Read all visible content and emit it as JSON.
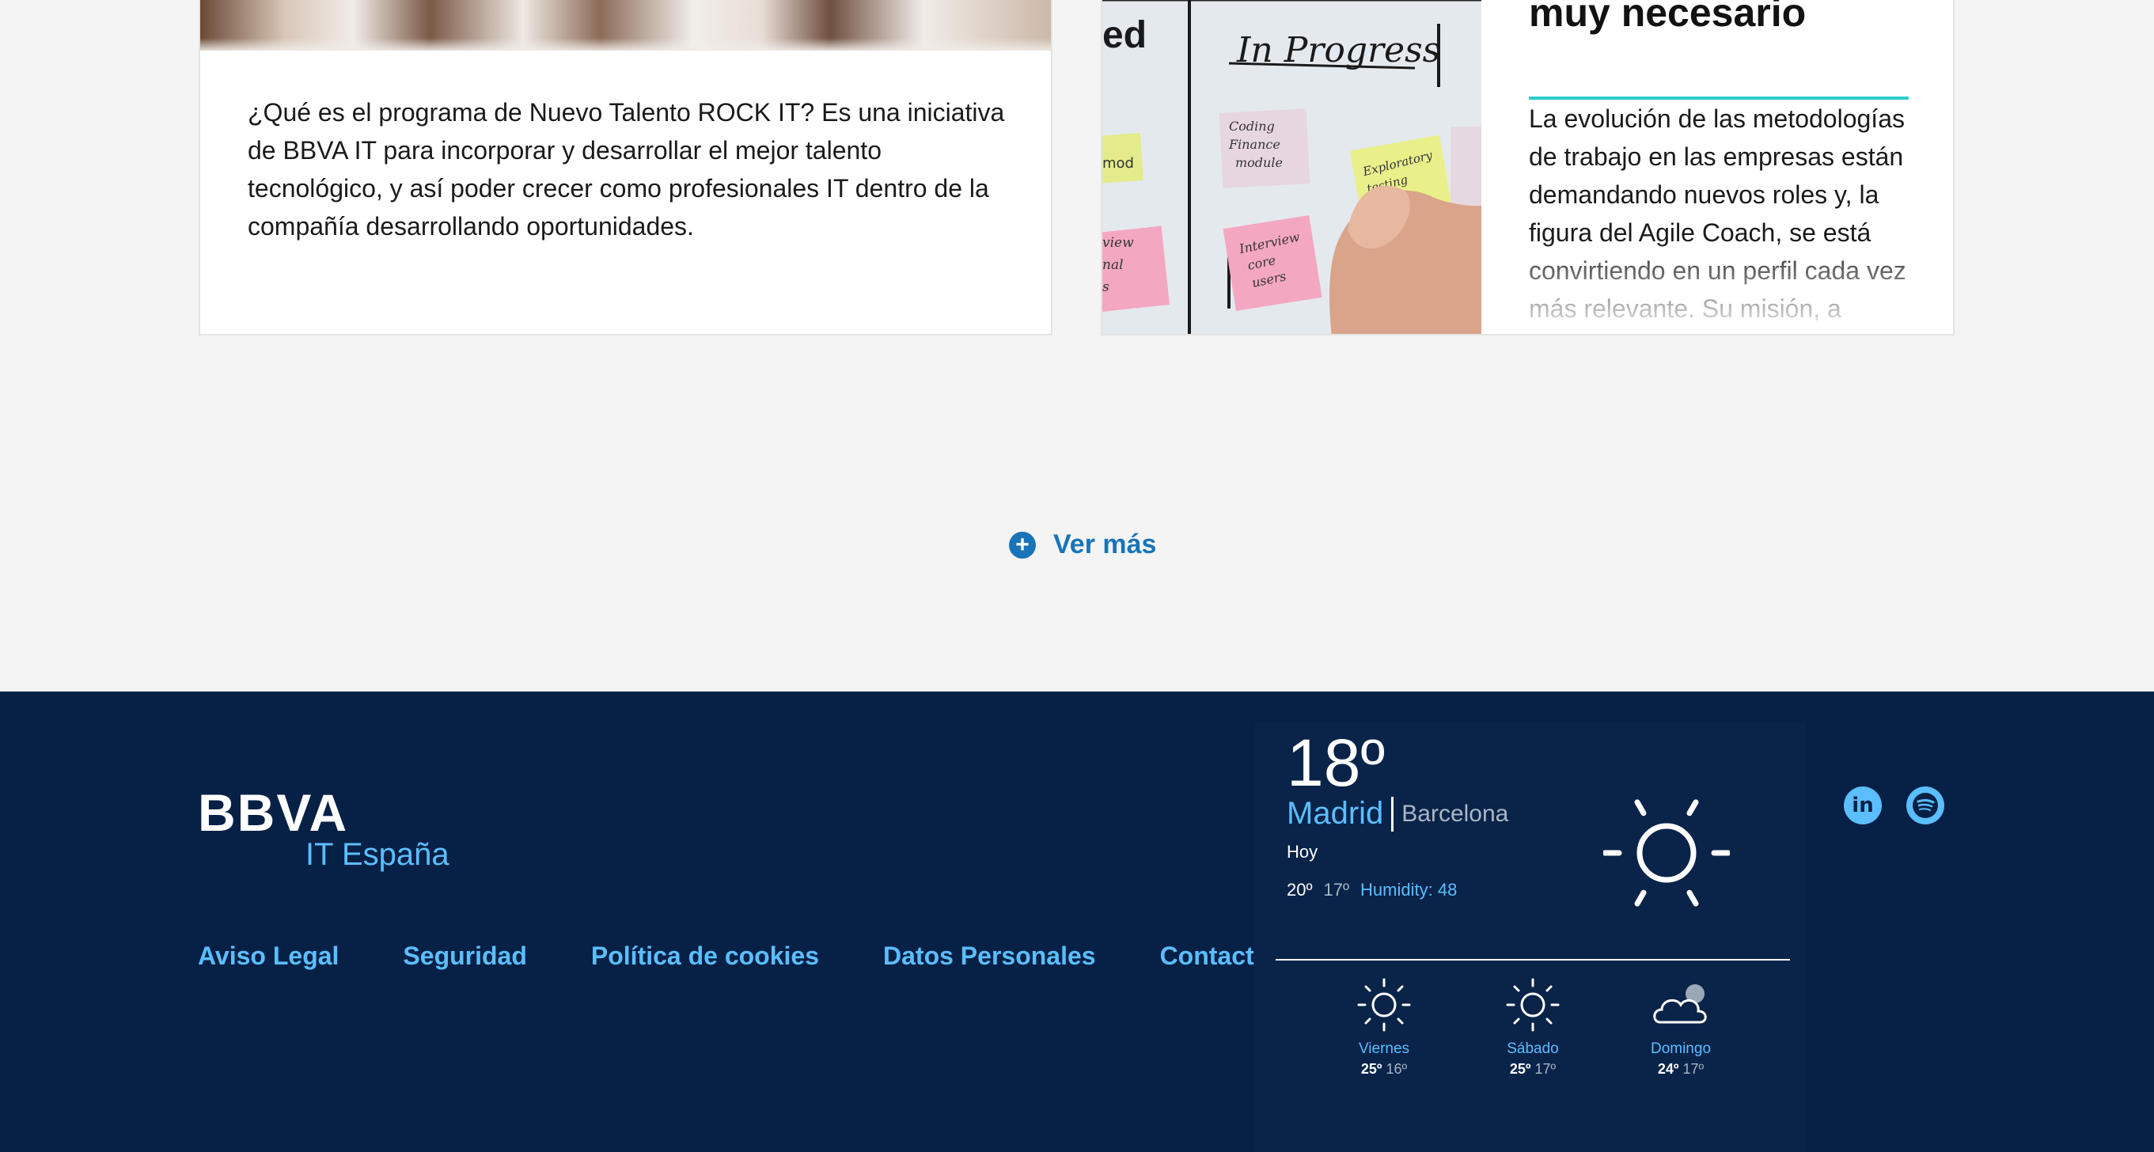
{
  "cards": {
    "left": {
      "text": "¿Qué es el programa de Nuevo Talento ROCK IT? Es una iniciativa de BBVA IT para incorporar y desarrollar el mejor talento tecnológico, y así poder crecer como profesionales IT dentro de la compañía desarrollando oportunidades."
    },
    "right": {
      "title": "muy necesario",
      "excerpt": "La evolución de las metodologías de trabajo en las empresas están demandando nuevos roles y, la figura del Agile Coach, se está convirtiendo en un perfil cada vez más relevante. Su misión, a",
      "board_heading": "In Progress",
      "board_fragment": "ed",
      "notes": [
        "Coding Finance module",
        "Explaratory testing \"Ops\"",
        "Interview core users",
        "mod",
        "view nal s"
      ]
    }
  },
  "ver_mas": {
    "label": "Ver más"
  },
  "footer": {
    "logo": {
      "brand": "BBVA",
      "sub": "IT España"
    },
    "links": [
      "Aviso Legal",
      "Seguridad",
      "Política de cookies",
      "Datos Personales",
      "Contacto"
    ],
    "weather": {
      "temp": "18º",
      "city_active": "Madrid",
      "city_other": "Barcelona",
      "today": "Hoy",
      "high": "20º",
      "low": "17º",
      "humidity": "Humidity: 48",
      "forecast": [
        {
          "day": "Viernes",
          "high": "25º",
          "low": "16º",
          "icon": "sun-icon"
        },
        {
          "day": "Sábado",
          "high": "25º",
          "low": "17º",
          "icon": "sun-icon"
        },
        {
          "day": "Domingo",
          "high": "24º",
          "low": "17º",
          "icon": "cloud-icon"
        }
      ]
    },
    "social": [
      "linkedin-icon",
      "spotify-icon"
    ]
  },
  "colors": {
    "background": "#f4f4f4",
    "footer": "#072146",
    "accent_blue": "#1973b8",
    "link_blue": "#5bbeff",
    "aqua": "#2dcccd"
  }
}
